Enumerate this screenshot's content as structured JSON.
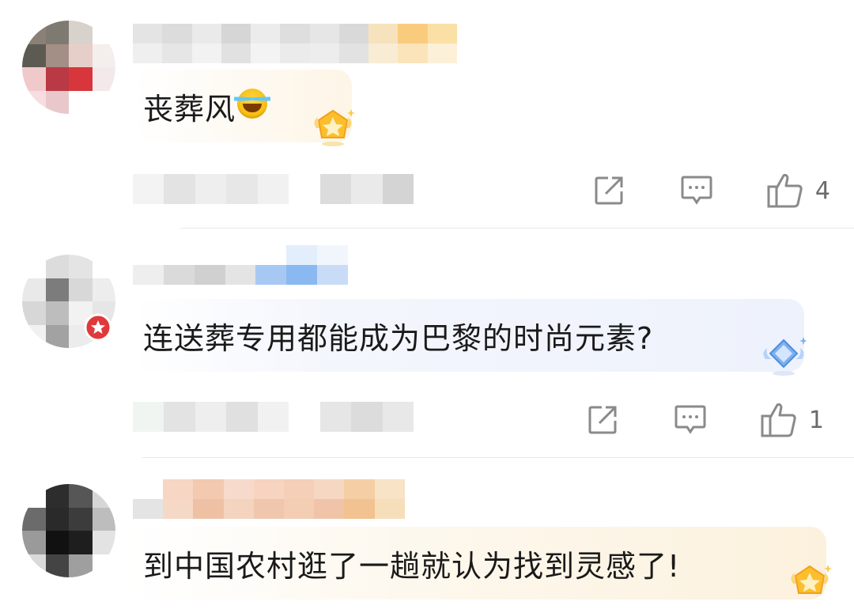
{
  "comments": [
    {
      "text": "丧葬风",
      "emoji": "tears-of-joy-emoji",
      "likes": "4",
      "badge": "gold-star-badge-icon",
      "bubble_color": "#fdf6e8"
    },
    {
      "text": "连送葬专用都能成为巴黎的时尚元素?",
      "likes": "1",
      "badge": "blue-diamond-badge-icon",
      "bubble_color": "#f2f5fd"
    },
    {
      "text": "到中国农村逛了一趟就认为找到灵感了!",
      "badge": "gold-star-badge-icon",
      "bubble_color": "#fdf6e8"
    }
  ],
  "icons": {
    "share": "share-icon",
    "reply": "comment-icon",
    "like": "thumbs-up-icon"
  },
  "colors": {
    "icon_gray": "#8a8a8a",
    "text": "#1a1a1a",
    "divider": "#e8e8e8"
  }
}
